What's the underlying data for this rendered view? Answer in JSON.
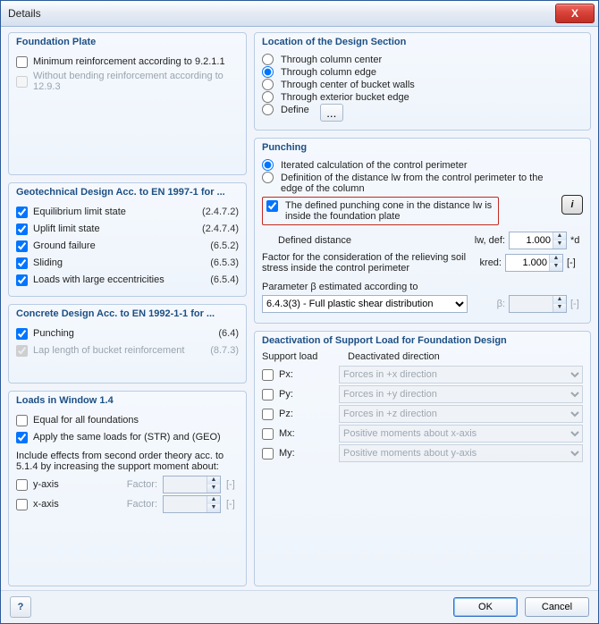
{
  "window": {
    "title": "Details"
  },
  "foundation_plate": {
    "title": "Foundation Plate",
    "min_reinf": "Minimum reinforcement according to 9.2.1.1",
    "min_reinf_checked": false,
    "no_bending": "Without bending reinforcement according to 12.9.3",
    "no_bending_checked": false
  },
  "geo": {
    "title": "Geotechnical Design Acc. to EN 1997-1 for ...",
    "items": [
      {
        "label": "Equilibrium limit state",
        "ref": "(2.4.7.2)",
        "checked": true
      },
      {
        "label": "Uplift limit state",
        "ref": "(2.4.7.4)",
        "checked": true
      },
      {
        "label": "Ground failure",
        "ref": "(6.5.2)",
        "checked": true
      },
      {
        "label": "Sliding",
        "ref": "(6.5.3)",
        "checked": true
      },
      {
        "label": "Loads with large eccentricities",
        "ref": "(6.5.4)",
        "checked": true
      }
    ]
  },
  "concrete": {
    "title": "Concrete Design Acc. to EN 1992-1-1 for ...",
    "punching": {
      "label": "Punching",
      "ref": "(6.4)",
      "checked": true
    },
    "lap": {
      "label": "Lap length of bucket reinforcement",
      "ref": "(8.7.3)",
      "checked": true
    }
  },
  "loads14": {
    "title": "Loads in Window 1.4",
    "equal": {
      "label": "Equal for all foundations",
      "checked": false
    },
    "same_str_geo": {
      "label": "Apply the same loads for (STR) and (GEO)",
      "checked": true
    },
    "note": "Include effects from second order theory acc. to 5.1.4 by increasing the support moment about:",
    "yaxis": {
      "label": "y-axis",
      "checked": false
    },
    "xaxis": {
      "label": "x-axis",
      "checked": false
    },
    "factor_label": "Factor:",
    "factor_value": "",
    "factor_unit": "[-]"
  },
  "design_section": {
    "title": "Location of the Design Section",
    "options": [
      "Through column center",
      "Through column edge",
      "Through center of bucket walls",
      "Through exterior bucket edge",
      "Define"
    ],
    "selected": 1,
    "define_btn": "..."
  },
  "punching": {
    "title": "Punching",
    "iterated": "Iterated calculation of the control perimeter",
    "def_dist": "Definition of the distance lw from the control perimeter to the edge of the column",
    "mode_selected": 0,
    "cone_inside": "The defined punching cone in the distance lw is inside the foundation plate",
    "cone_inside_checked": true,
    "defined_distance_label": "Defined distance",
    "lw_sym": "lw, def:",
    "lw_val": "1.000",
    "lw_unit": "*d",
    "relief_label": "Factor for the consideration of the relieving soil stress inside the control perimeter",
    "kred_sym": "kred:",
    "kred_val": "1.000",
    "kred_unit": "[-]",
    "beta_label": "Parameter β estimated according to",
    "beta_option": "6.4.3(3) - Full plastic shear distribution",
    "beta_sym": "β:",
    "beta_val": "",
    "beta_unit": "[-]"
  },
  "deact": {
    "title": "Deactivation of Support Load for Foundation Design",
    "h_support": "Support load",
    "h_dir": "Deactivated direction",
    "rows": [
      {
        "sym": "Px:",
        "dir": "Forces in +x direction"
      },
      {
        "sym": "Py:",
        "dir": "Forces in +y direction"
      },
      {
        "sym": "Pz:",
        "dir": "Forces in +z direction"
      },
      {
        "sym": "Mx:",
        "dir": "Positive moments about x-axis"
      },
      {
        "sym": "My:",
        "dir": "Positive moments about y-axis"
      }
    ]
  },
  "footer": {
    "ok": "OK",
    "cancel": "Cancel"
  }
}
